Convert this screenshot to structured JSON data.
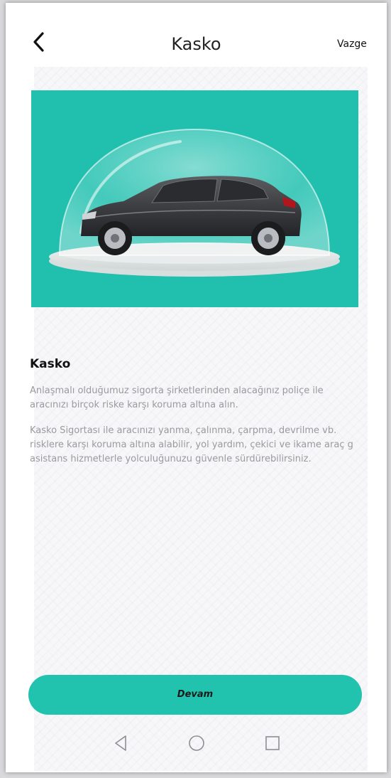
{
  "header": {
    "title": "Kasko",
    "cancel_label": "Vazge"
  },
  "product": {
    "title": "Kasko",
    "description_1": [
      "Anlaşmalı olduğumuz sigorta şirketlerinden alacağınız poliçe ile",
      "aracınızı birçok riske karşı koruma altına alın."
    ],
    "description_2": [
      "Kasko Sigortası ile aracınızı  yanma, çalınma, çarpma, devrilme vb.",
      "risklere karşı koruma altına alabilir, yol yardım, çekici ve ikame araç g",
      "asistans hizmetlerle yolculuğunuzu güvenle sürdürebilirsiniz."
    ]
  },
  "actions": {
    "continue_label": "Devam"
  },
  "navigation": {
    "icons": [
      "back-triangle-icon",
      "home-circle-icon",
      "recents-square-icon"
    ]
  },
  "colors": {
    "accent": "#22c3ae",
    "hero_background": "#21bfae",
    "text_primary": "#111111",
    "text_secondary": "#9a9a9f"
  }
}
